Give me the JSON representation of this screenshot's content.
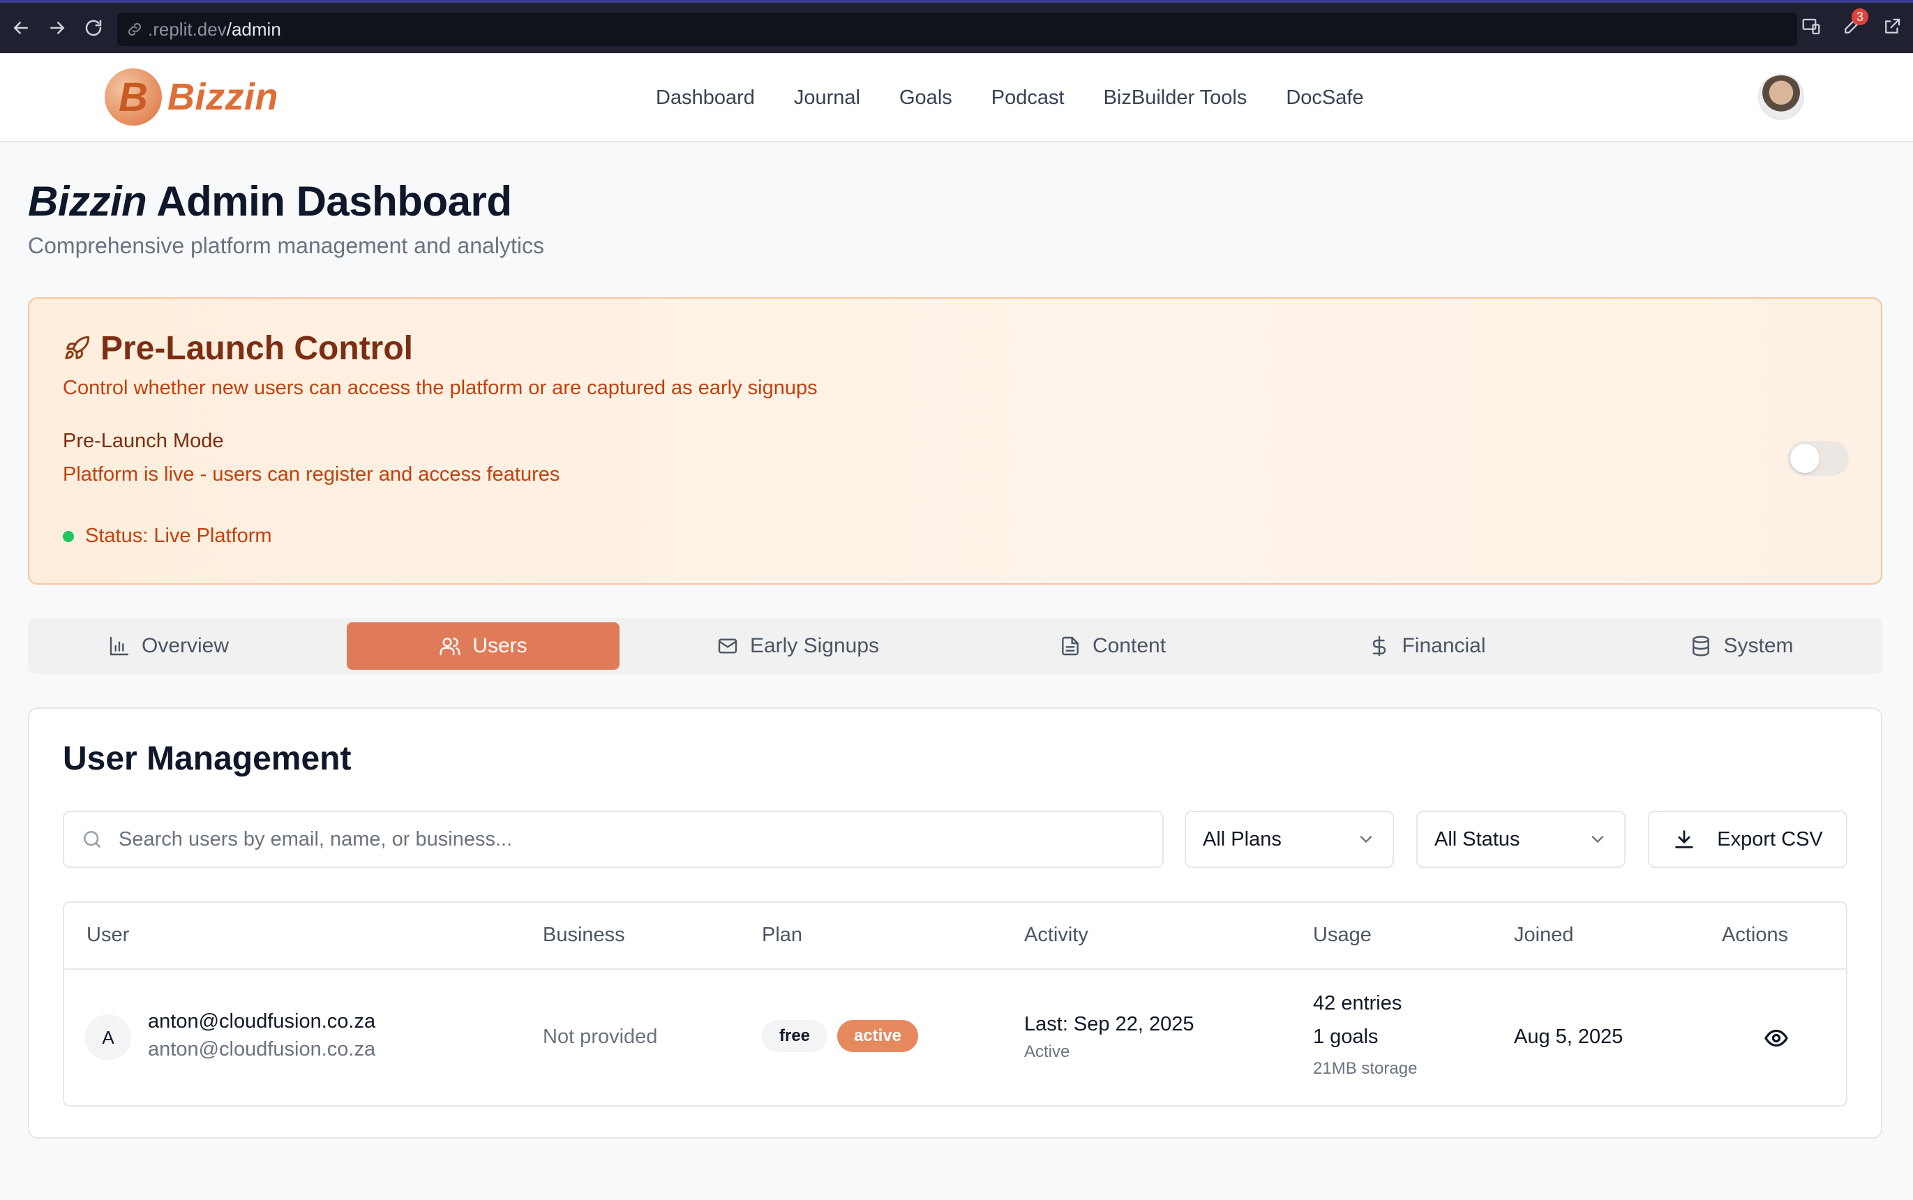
{
  "browser": {
    "url_prefix": ".replit.dev",
    "url_path": "/admin",
    "badge_count": "3"
  },
  "header": {
    "logo_letter": "B",
    "logo_text": "Bizzin",
    "nav": [
      "Dashboard",
      "Journal",
      "Goals",
      "Podcast",
      "BizBuilder Tools",
      "DocSafe"
    ]
  },
  "page": {
    "title_brand": "Bizzin",
    "title_rest": " Admin Dashboard",
    "subtitle": "Comprehensive platform management and analytics"
  },
  "prelaunch": {
    "title": "Pre-Launch Control",
    "description": "Control whether new users can access the platform or are captured as early signups",
    "mode_label": "Pre-Launch Mode",
    "mode_description": "Platform is live - users can register and access features",
    "status": "Status: Live Platform",
    "toggle_on": false,
    "status_color": "#22c55e"
  },
  "tabs": [
    {
      "label": "Overview",
      "icon": "bar-chart-icon",
      "active": false
    },
    {
      "label": "Users",
      "icon": "users-icon",
      "active": true
    },
    {
      "label": "Early Signups",
      "icon": "mail-icon",
      "active": false
    },
    {
      "label": "Content",
      "icon": "file-text-icon",
      "active": false
    },
    {
      "label": "Financial",
      "icon": "dollar-icon",
      "active": false
    },
    {
      "label": "System",
      "icon": "database-icon",
      "active": false
    }
  ],
  "user_management": {
    "title": "User Management",
    "search_placeholder": "Search users by email, name, or business...",
    "plan_filter": "All Plans",
    "status_filter": "All Status",
    "export_label": "Export CSV",
    "columns": [
      "User",
      "Business",
      "Plan",
      "Activity",
      "Usage",
      "Joined",
      "Actions"
    ],
    "rows": [
      {
        "avatar_initial": "A",
        "email": "anton@cloudfusion.co.za",
        "name": "anton@cloudfusion.co.za",
        "business": "Not provided",
        "plan": "free",
        "plan_status": "active",
        "activity_last": "Last: Sep 22, 2025",
        "activity_state": "Active",
        "usage_entries": "42 entries",
        "usage_goals": "1 goals",
        "usage_storage": "21MB storage",
        "joined": "Aug 5, 2025"
      }
    ]
  },
  "colors": {
    "accent": "#e07b59",
    "brand": "#e06d35"
  }
}
